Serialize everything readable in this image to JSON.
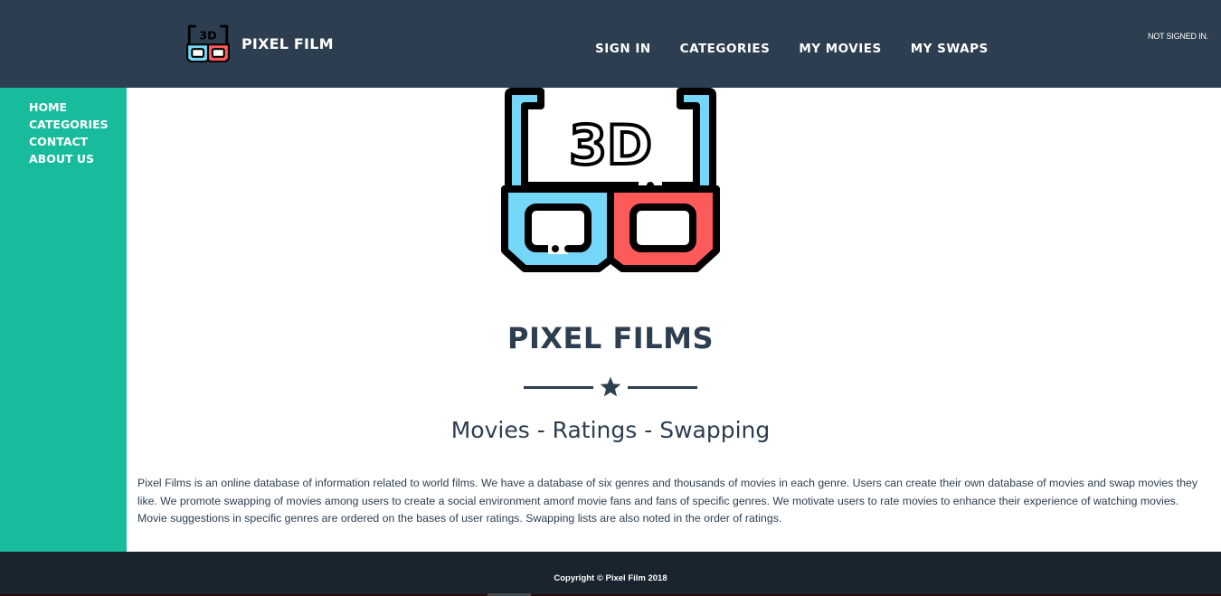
{
  "header": {
    "brand": "PIXEL FILM",
    "logo_text": "3D",
    "nav": [
      "SIGN IN",
      "CATEGORIES",
      "MY MOVIES",
      "MY SWAPS"
    ],
    "status": "NOT SIGNED IN."
  },
  "sidebar": {
    "items": [
      "HOME",
      "CATEGORIES",
      "CONTACT",
      "ABOUT US"
    ]
  },
  "main": {
    "logo_text": "3D",
    "title": "PIXEL FILMS",
    "divider_icon": "star-icon",
    "subtitle": "Movies - Ratings - Swapping",
    "description": "Pixel Films is an online database of information related to world films. We have a database of six genres and thousands of movies in each genre. Users can create their own database of movies and swap movies they like. We promote swapping of movies among users to create a social environment amonf movie fans and fans of specific genres. We motivate users to rate movies to enhance their experience of watching movies. Movie suggestions in specific genres are ordered on the bases of user ratings. Swapping lists are also noted in the order of ratings."
  },
  "footer": {
    "copyright": "Copyright © Pixel Film 2018"
  },
  "colors": {
    "header_bg": "#2c3e50",
    "sidebar_bg": "#18bc9c",
    "footer_bg": "#1a242f",
    "lens_left": "#74d7f7",
    "lens_right": "#ff5a5a",
    "text_dark": "#2c3e50"
  }
}
